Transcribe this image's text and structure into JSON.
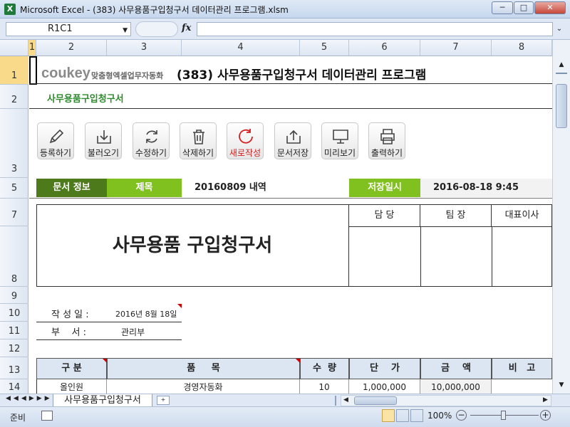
{
  "window": {
    "title": "Microsoft Excel - (383) 사무용품구입청구서 데이터관리 프로그램.xlsm",
    "app_icon": "X"
  },
  "formula_bar": {
    "name_box": "R1C1",
    "fx_label": "fx",
    "formula": ""
  },
  "columns": [
    "1",
    "2",
    "3",
    "4",
    "5",
    "6",
    "7",
    "8"
  ],
  "rows": [
    "1",
    "2",
    "3",
    "5",
    "7",
    "8",
    "9",
    "10",
    "11",
    "12",
    "13",
    "14"
  ],
  "brand": {
    "logo": "coukey",
    "tagline": "맞춤형엑셀업무자동화",
    "title": "(383) 사무용품구입청구서 데이터관리 프로그램"
  },
  "subtitle": "사무용품구입청구서",
  "toolbar": [
    {
      "label": "등록하기",
      "icon": "pencil-icon"
    },
    {
      "label": "불러오기",
      "icon": "download-tray-icon"
    },
    {
      "label": "수정하기",
      "icon": "refresh-icon"
    },
    {
      "label": "삭제하기",
      "icon": "trash-icon"
    },
    {
      "label": "새로작성",
      "icon": "new-circle-icon"
    },
    {
      "label": "문서저장",
      "icon": "upload-tray-icon"
    },
    {
      "label": "미리보기",
      "icon": "monitor-icon"
    },
    {
      "label": "출력하기",
      "icon": "printer-icon"
    }
  ],
  "doc_info": {
    "label": "문서 정보",
    "title_label": "제목",
    "title_value": "20160809 내역",
    "saved_label": "저장일시",
    "saved_value": "2016-08-18 9:45"
  },
  "form": {
    "heading": "사무용품 구입청구서",
    "approvals": [
      "담 당",
      "팀 장",
      "대표이사"
    ],
    "date_label": "작 성 일 :",
    "date_value": "2016년 8월 18일",
    "dept_label": "부    서 :",
    "dept_value": "관리부"
  },
  "table": {
    "headers": [
      "구 분",
      "품     목",
      "수  량",
      "단    가",
      "금    액",
      "비   고"
    ],
    "rows": [
      [
        "올인원",
        "경영자동화",
        "10",
        "1,000,000",
        "10,000,000",
        ""
      ]
    ]
  },
  "sheet_tab": "사무용품구입청구서",
  "status": {
    "mode": "준비",
    "zoom": "100%"
  },
  "colors": {
    "accent_dark": "#4d7a1a",
    "accent_light": "#80c01f",
    "header_blue": "#dce6f2"
  }
}
